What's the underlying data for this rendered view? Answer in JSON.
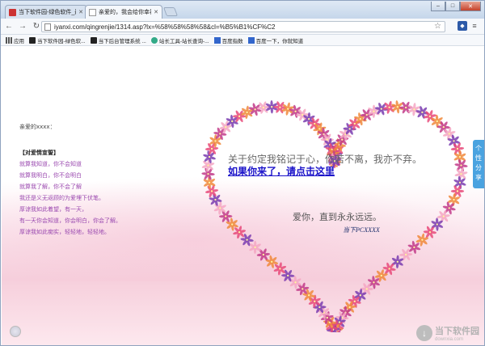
{
  "browser": {
    "tabs": [
      {
        "label": "当下软件园-绿色软件_最新",
        "active": false
      },
      {
        "label": "亲爱的，我会给你幸福(▷",
        "active": true
      }
    ],
    "window_controls": {
      "minimize": "–",
      "maximize": "□",
      "close": "✕"
    },
    "url": "iyanxi.com/qingrenjie/1314.asp?lx=%58%58%58%58&cl=%B5%B1%CF%C2",
    "bookmarks": [
      {
        "label": "应用",
        "icon": "apps-grid-icon"
      },
      {
        "label": "当下软件园-绿色软...",
        "icon": "downxia-logo-icon"
      },
      {
        "label": "当下后台管理系统 ...",
        "icon": "downxia-logo-icon"
      },
      {
        "label": "站长工具-站长查询-...",
        "icon": "chinaz-logo-icon"
      },
      {
        "label": "百度指数",
        "icon": "baidu-icon"
      },
      {
        "label": "百度一下，你就知道",
        "icon": "baidu-icon"
      }
    ]
  },
  "page": {
    "letter": {
      "greeting": "亲爱的xxxx：",
      "heading": "【对爱情宣誓】",
      "lines": [
        "就算我知道，你不会知道",
        "就算我明白，你不会明白",
        "就算我了解，你不会了解",
        "我还是义无返顾的为爱埋下伏笔。",
        "厚谅我如此着望，有一天，",
        "有一天你会知道，你会明白，你会了解。",
        "厚谅我如此痴实，轻轻地，轻轻地。"
      ]
    },
    "promise": "关于约定我铭记于心，你若不离，我亦不弃。",
    "link": "如果你来了，请点击这里",
    "love_forever": "爱你，直到永永远远。",
    "signature": "当下PCXXXX",
    "share_tab": [
      "个",
      "性",
      "分",
      "享"
    ],
    "watermark": {
      "title": "当下软件园",
      "url": "downxia.com"
    }
  },
  "colors": {
    "link": "#1a12c9",
    "letter_text": "#9b4ab0",
    "share_tab": "#4aa3e0",
    "heart_petals": [
      "#e84a7a",
      "#f08a3c",
      "#c23b8a",
      "#f5a7c3",
      "#7a3db0"
    ]
  }
}
